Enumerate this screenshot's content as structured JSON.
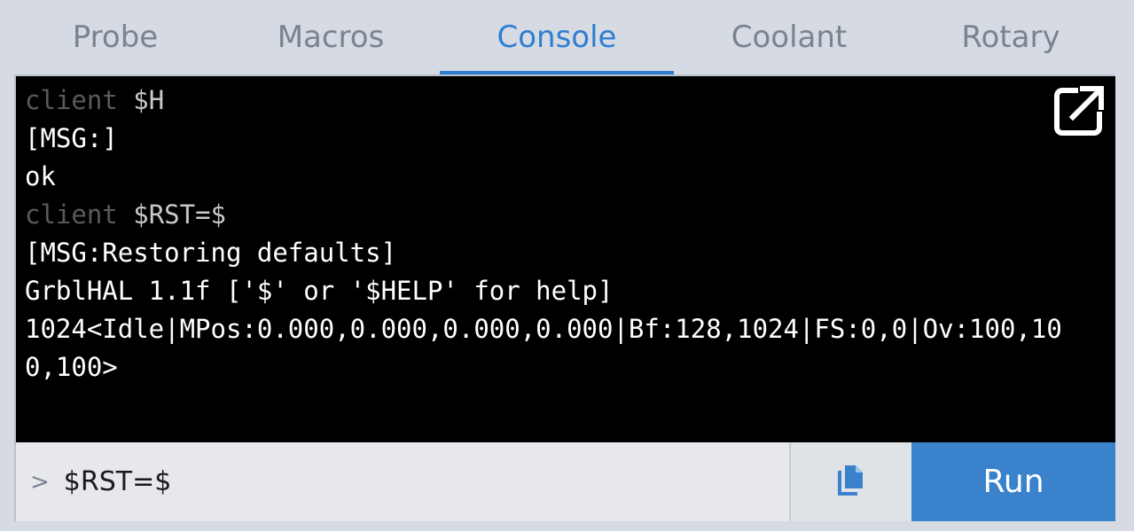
{
  "tabs": [
    {
      "label": "Probe"
    },
    {
      "label": "Macros"
    },
    {
      "label": "Console"
    },
    {
      "label": "Coolant"
    },
    {
      "label": "Rotary"
    }
  ],
  "active_tab": "Console",
  "console": {
    "lines": [
      {
        "type": "client",
        "tag": "client",
        "text": "$H"
      },
      {
        "type": "output",
        "text": "[MSG:]"
      },
      {
        "type": "output",
        "text": "ok"
      },
      {
        "type": "client",
        "tag": "client",
        "text": "$RST=$"
      },
      {
        "type": "output",
        "text": "[MSG:Restoring defaults]"
      },
      {
        "type": "output",
        "text": "GrblHAL 1.1f ['$' or '$HELP' for help]"
      },
      {
        "type": "output",
        "text": "1024<Idle|MPos:0.000,0.000,0.000,0.000|Bf:128,1024|FS:0,0|Ov:100,100,100>"
      }
    ],
    "popout_icon": "open-in-new-icon"
  },
  "input": {
    "prompt": ">",
    "value": "$RST=$"
  },
  "buttons": {
    "copy_icon": "copy-icon",
    "run_label": "Run"
  },
  "colors": {
    "accent": "#2f7ed0",
    "run_button": "#3a83cc",
    "console_bg": "#000000",
    "client_tag": "#5a5a5a"
  }
}
